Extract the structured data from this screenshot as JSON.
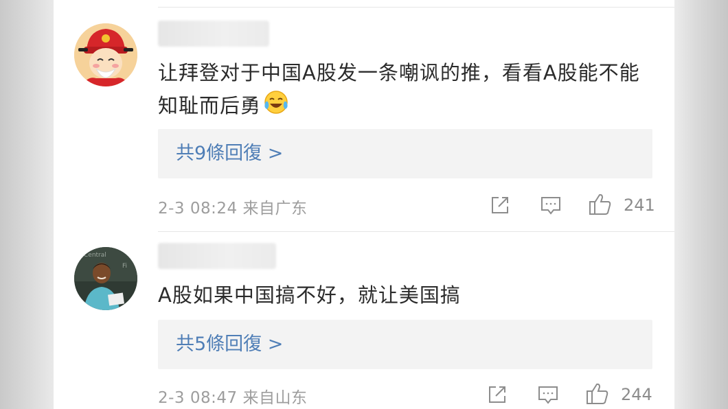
{
  "comments": [
    {
      "avatar_icon": "cartoon-official-avatar-icon",
      "text": "让拜登对于中国A股发一条嘲讽的推，看看A股能不能知耻而后勇",
      "emoji_icon": "laughing-crying-emoji-icon",
      "replies_label": "共9條回復 >",
      "timestamp": "2-3 08:24",
      "location": "来自广东",
      "like_count": "241"
    },
    {
      "avatar_icon": "boy-photo-avatar-icon",
      "text": "A股如果中国搞不好，就让美国搞",
      "replies_label": "共5條回復 >",
      "timestamp": "2-3 08:47",
      "location": "来自山东",
      "like_count": "244"
    }
  ],
  "colors": {
    "link_blue": "#4f7eb6",
    "meta_gray": "#9d9d9d",
    "reply_box_bg": "#f3f3f3"
  }
}
